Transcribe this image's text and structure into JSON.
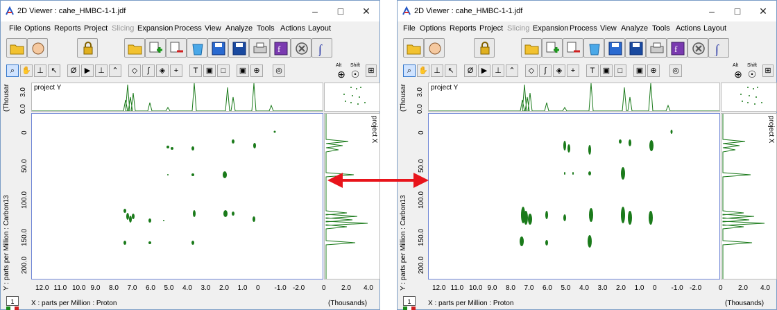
{
  "windows": [
    {
      "title": "2D Viewer : cahe_HMBC-1-1.jdf",
      "menu": [
        "File",
        "Options",
        "Reports",
        "Project",
        "Slicing",
        "Expansion",
        "Process",
        "View",
        "Analyze",
        "Tools",
        "Actions",
        "Layout"
      ],
      "disabled_menu": [
        "Slicing"
      ],
      "top_projection_label": "project Y",
      "right_projection_label": "project X",
      "top_axis_unit": "(Thousar",
      "top_axis_ticks": [
        "3.0",
        "0.0"
      ],
      "y_axis_label": "Y : parts per Million : Carbon13",
      "y_ticks": [
        "0",
        "50.0",
        "100.0",
        "150.0",
        "200.0"
      ],
      "x_axis_label": "X : parts per Million : Proton",
      "x_ticks": [
        "12.0",
        "11.0",
        "10.0",
        "9.0",
        "8.0",
        "7.0",
        "6.0",
        "5.0",
        "4.0",
        "3.0",
        "2.0",
        "1.0",
        "0",
        "-1.0",
        "-2.0"
      ],
      "right_axis_ticks": [
        "0",
        "2.0",
        "4.0"
      ],
      "right_axis_unit": "(Thousands)",
      "page_number": "1",
      "modifiers": {
        "alt": "Alt",
        "shift": "Shift"
      }
    },
    {
      "title": "2D Viewer : cahe_HMBC-1-1.jdf",
      "menu": [
        "File",
        "Options",
        "Reports",
        "Project",
        "Slicing",
        "Expansion",
        "Process",
        "View",
        "Analyze",
        "Tools",
        "Actions",
        "Layout"
      ],
      "disabled_menu": [
        "Slicing"
      ],
      "top_projection_label": "project Y",
      "right_projection_label": "project X",
      "top_axis_unit": "(Thousar",
      "top_axis_ticks": [
        "3.0",
        "0.0"
      ],
      "y_axis_label": "Y : parts per Million : Carbon13",
      "y_ticks": [
        "0",
        "50.0",
        "100.0",
        "150.0",
        "200.0"
      ],
      "x_axis_label": "X : parts per Million : Proton",
      "x_ticks": [
        "12.0",
        "11.0",
        "10.0",
        "9.0",
        "8.0",
        "7.0",
        "6.0",
        "5.0",
        "4.0",
        "3.0",
        "2.0",
        "1.0",
        "0",
        "-1.0",
        "-2.0"
      ],
      "right_axis_ticks": [
        "0",
        "2.0",
        "4.0"
      ],
      "right_axis_unit": "(Thousands)",
      "page_number": "1",
      "modifiers": {
        "alt": "Alt",
        "shift": "Shift"
      }
    }
  ],
  "colors": {
    "peak": "#1a7a1a",
    "arrow": "#e8141b",
    "frame": "#6f86d6"
  },
  "toolbar_icons": [
    "open-folder-icon",
    "hand-tool-icon",
    "lock-icon",
    "open-folder-icon",
    "add-data-icon",
    "remove-data-icon",
    "trash-icon",
    "save-icon",
    "save-as-icon",
    "print-icon",
    "process-icon",
    "cancel-icon",
    "integral-icon"
  ],
  "tool_icons": [
    "zoom-icon",
    "pan-icon",
    "peak-pick-icon",
    "pointer-icon",
    "null-icon",
    "select-arrow-icon",
    "baseline-icon",
    "peak-icon",
    "diamond-icon",
    "integral-small-icon",
    "eraser-icon",
    "plus-icon",
    "text-icon",
    "frame-icon",
    "box-icon",
    "center-icon",
    "crosshair-icon",
    "target-icon"
  ]
}
